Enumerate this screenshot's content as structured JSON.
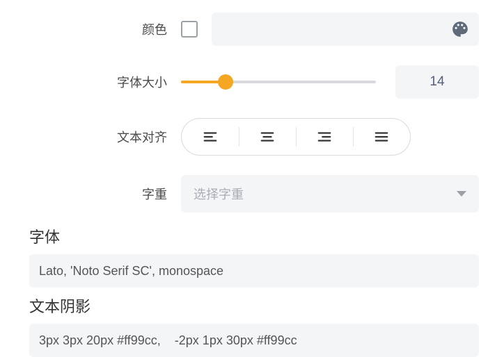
{
  "color": {
    "label": "颜色"
  },
  "fontSize": {
    "label": "字体大小",
    "value": "14"
  },
  "textAlign": {
    "label": "文本对齐"
  },
  "fontWeight": {
    "label": "字重",
    "placeholder": "选择字重"
  },
  "fontFamily": {
    "label": "字体",
    "value": "Lato, 'Noto Serif SC', monospace"
  },
  "textShadow": {
    "label": "文本阴影",
    "value": "3px 3px 20px #ff99cc,    -2px 1px 30px #ff99cc"
  }
}
